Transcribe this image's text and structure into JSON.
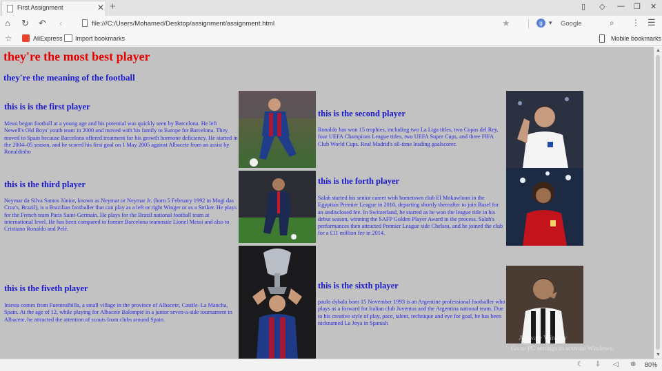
{
  "browser": {
    "tab_title": "First Assignment",
    "url": "file:///C:/Users/Mohamed/Desktop/assignment/assignment.html",
    "search_engine": "Google",
    "bookmarks": [
      "AliExpress",
      "Import bookmarks"
    ],
    "mobile_bookmarks": "Mobile bookmarks",
    "zoom": "80%"
  },
  "page": {
    "title": "they're the most best player",
    "subtitle": "they're the meaning of the football",
    "players": [
      {
        "heading": "this is is the first player",
        "text": "Messi began football at a young age and his potential was quickly seen by Barcelona. He left Newell's Old Boys' youth team in 2000 and moved with his family to Europe for Barcelona. They moved to Spain because Barcelona offered treatment for his growth hormone deficiency. He started in the 2004–05 season, and he scored his first goal on 1 May 2005 against Albacete from an assist by Ronaldinho"
      },
      {
        "heading": "this is the second player",
        "text": "Ronaldo has won 15 trophies, including two La Liga titles, two Copas del Rey, four UEFA Champions League titles, two UEFA Super Cups, and three FIFA Club World Cups. Real Madrid's all-time leading goalscorer."
      },
      {
        "heading": "this is the third player",
        "text": "Neymar da Silva Santos Júnior, known as Neymar or Neymar Jr. (born 5 February 1992 in Mogi das Cruz's, Brazil), is a Brazilian footballer that can play as a left or right Winger or as a Striker. He plays for the French team Paris Saint-Germain. He plays for the Brazil national football team at international level. He has been compared to former Barcelona teammate Lionel Messi and also to Cristiano Ronaldo and Pelé."
      },
      {
        "heading": "this is the forth player",
        "text": "Salah started his senior career with hometown club El Mokawloon in the Egyptian Premier League in 2010, departing shortly thereafter to join Basel for an undisclosed fee. In Switzerland, he starred as he won the league title in his debut season, winning the SAFP Golden Player Award in the process. Salah's performances then attracted Premier League side Chelsea, and he joined the club for a £11 million fee in 2014."
      },
      {
        "heading": "this is the fiveth player",
        "text": "Iniesta comes from Fuentealbilla, a small village in the province of Albacete, Castile–La Mancha, Spain. At the age of 12, while playing for Albacete Balompié in a junior seven-a-side tournament in Albacete, he attracted the attention of scouts from clubs around Spain."
      },
      {
        "heading": "this is the sixth player",
        "text": "paulo dybala born 15 November 1993 is an Argentine professional footballer who plays as a forward for Italian club Juventus and the Argentina national team. Due to his creative style of play, pace, talent, technique and eye for goal, he has been nicknamed La Joya in Spanish"
      }
    ]
  },
  "watermark": {
    "line1": "Activate Window",
    "line2": "Go to PC settings to activate Windows."
  },
  "colors": {
    "page_bg": "#c2c2c2",
    "title": "#e60000",
    "heading": "#1a1acc",
    "body_text": "#2a2ae0"
  },
  "icons": {
    "tab": "page-icon",
    "nav": [
      "home-icon",
      "reload-icon",
      "undo-icon",
      "back-icon"
    ],
    "status": [
      "night-mode-icon",
      "download-icon",
      "volume-icon",
      "zoom-icon"
    ]
  }
}
